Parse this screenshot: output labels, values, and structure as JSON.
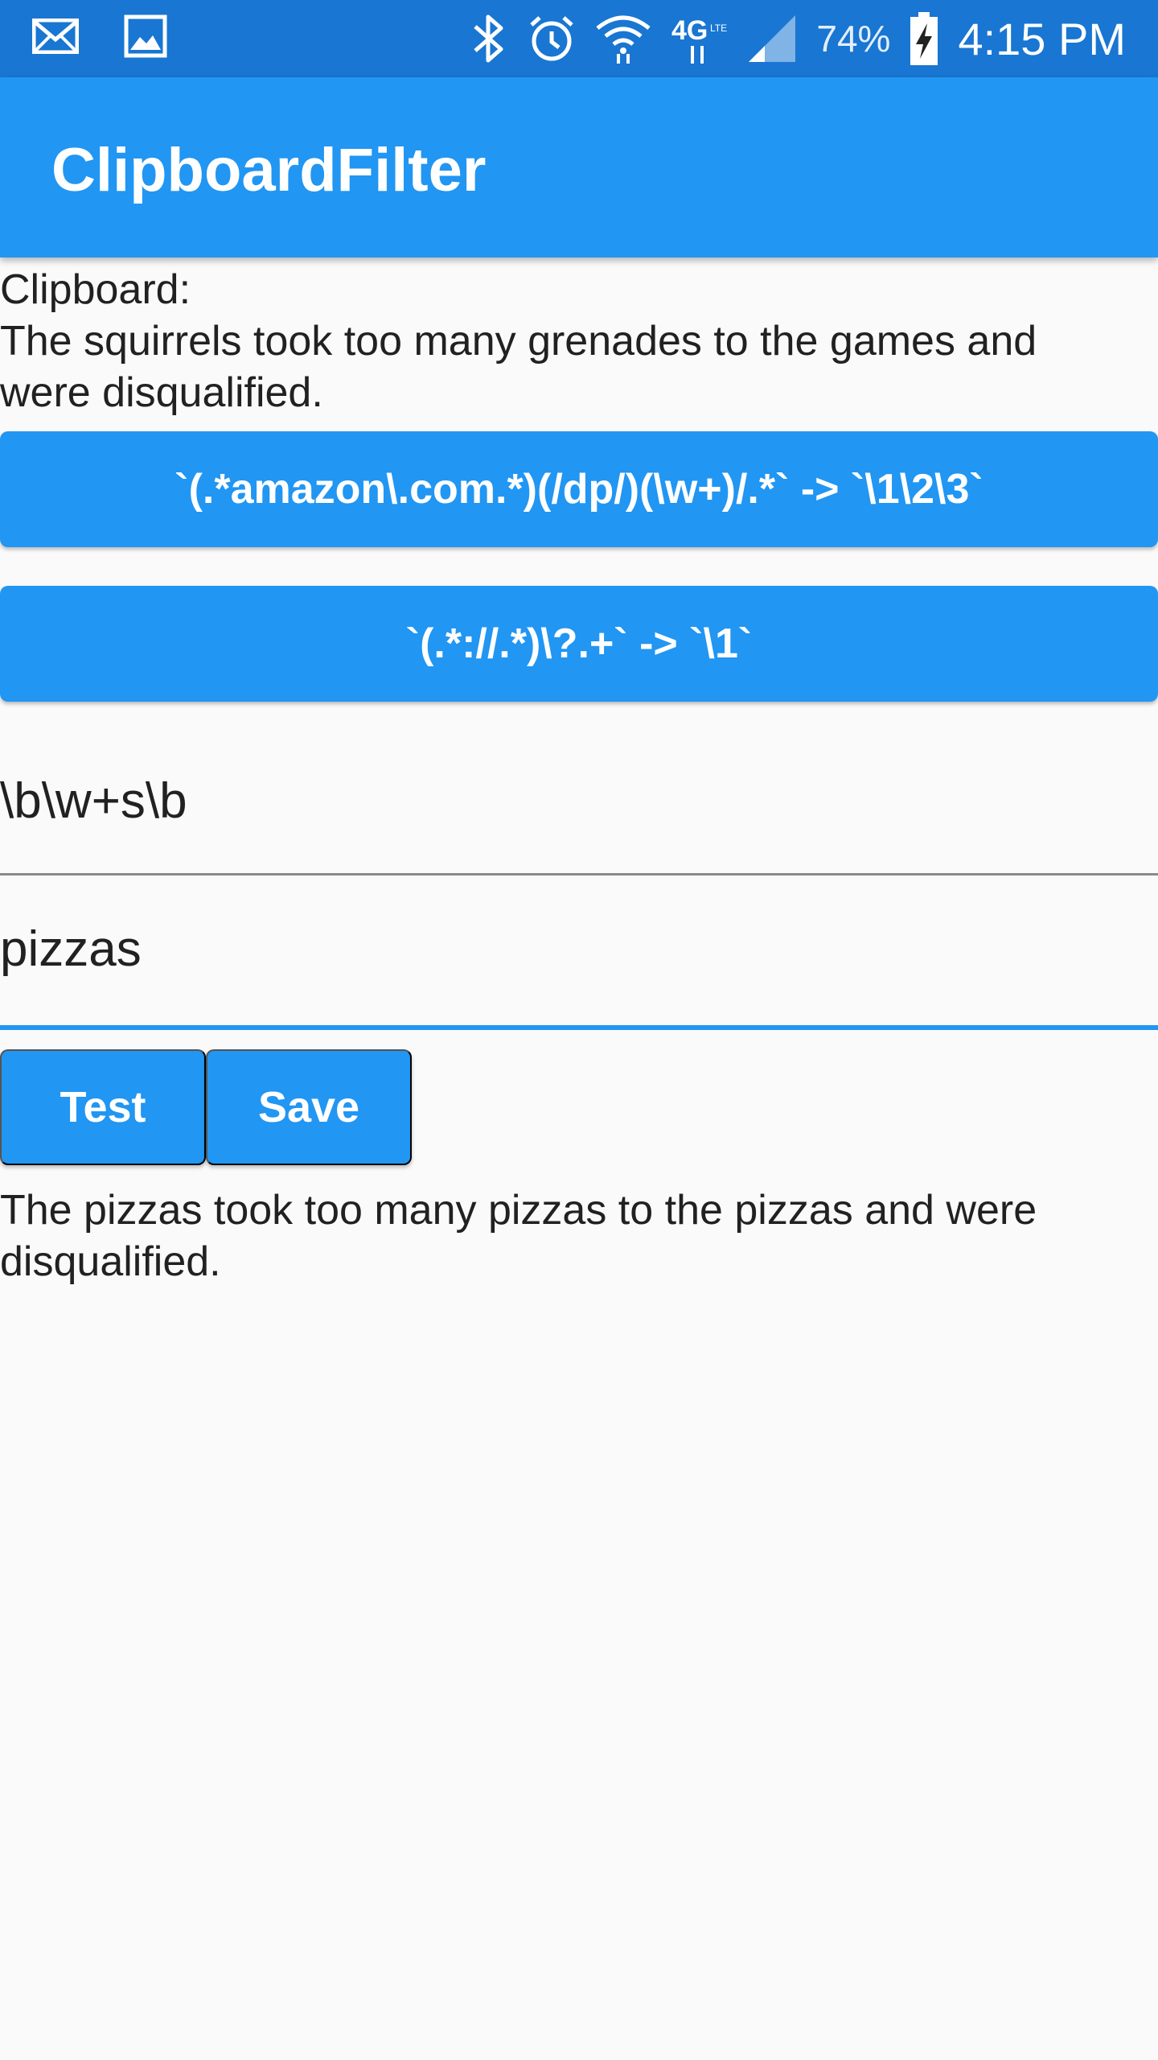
{
  "status_bar": {
    "left_icons": [
      "mail-icon",
      "image-icon"
    ],
    "right_icons": [
      "bluetooth-icon",
      "alarm-icon",
      "wifi-icon",
      "4g-lte-icon",
      "signal-icon",
      "battery-charging-icon"
    ],
    "battery_percent": "74%",
    "time": "4:15 PM"
  },
  "app_bar": {
    "title": "ClipboardFilter"
  },
  "clipboard": {
    "label": "Clipboard:",
    "text": "The squirrels took too many grenades to the games and were disqualified."
  },
  "filters": [
    {
      "label": "`(.*amazon\\.com.*)(/dp/)(\\w+)/.*` -> `\\1\\2\\3`"
    },
    {
      "label": "`(.*://.*)\\?.+` -> `\\1`"
    }
  ],
  "pattern_field": {
    "value": "\\b\\w+s\\b"
  },
  "replacement_field": {
    "value": "pizzas"
  },
  "actions": {
    "test_label": "Test",
    "save_label": "Save"
  },
  "result": {
    "text": "The pizzas took too many pizzas to the pizzas and were disqualified."
  },
  "colors": {
    "status_bar": "#1976d2",
    "primary": "#2196f3",
    "background": "#fafafa",
    "text": "#212121"
  }
}
